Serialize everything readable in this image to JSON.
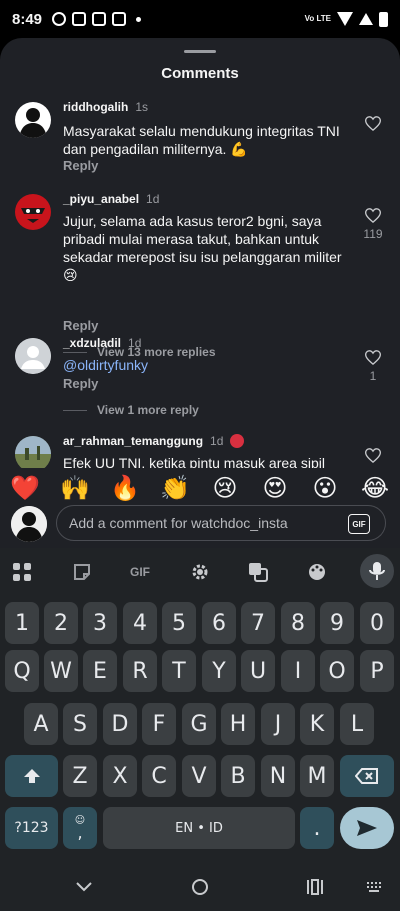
{
  "status_bar": {
    "time": "8:49",
    "network_label": "Vo LTE"
  },
  "sheet": {
    "title": "Comments"
  },
  "comments": [
    {
      "username": "riddhogalih",
      "time": "1s",
      "text": "Masyarakat selalu mendukung integritas TNI dan pengadilan militernya. 💪",
      "reply_label": "Reply",
      "like_count": ""
    },
    {
      "username": "_piyu_anabel",
      "time": "1d",
      "text": "Jujur, selama ada kasus teror2 bgni, saya pribadi mulai merasa takut, bahkan untuk sekadar merepost isu isu pelanggaran militer 😢",
      "reply_label": "Reply",
      "like_count": "119",
      "view_replies": "View 13 more replies"
    },
    {
      "username": "_xdzuladil",
      "time": "1d",
      "text": "@oldirtyfunky",
      "reply_label": "Reply",
      "like_count": "1",
      "view_replies": "View 1 more reply"
    },
    {
      "username": "ar_rahman_temanggung",
      "time": "1d",
      "text": "Efek UU TNI, ketika pintu masuk area sipil",
      "reply_label": "",
      "like_count": ""
    }
  ],
  "emoji_bar": [
    "❤️",
    "🙌",
    "🔥",
    "👏",
    "😢",
    "😍",
    "😮",
    "😂"
  ],
  "composer": {
    "placeholder": "Add a comment for watchdoc_insta",
    "gif_label": "GIF"
  },
  "keyboard": {
    "toolbar_gif_label": "GIF",
    "number_row": [
      "1",
      "2",
      "3",
      "4",
      "5",
      "6",
      "7",
      "8",
      "9",
      "0"
    ],
    "row1": [
      "Q",
      "W",
      "E",
      "R",
      "T",
      "Y",
      "U",
      "I",
      "O",
      "P"
    ],
    "row2": [
      "A",
      "S",
      "D",
      "F",
      "G",
      "H",
      "J",
      "K",
      "L"
    ],
    "row3": [
      "Z",
      "X",
      "C",
      "V",
      "B",
      "N",
      "M"
    ],
    "symbols_label": "?123",
    "comma_label": ",",
    "space_label": "EN • ID",
    "period_label": "."
  },
  "colors": {
    "sheet_background": "#1f2126",
    "keyboard_background": "#202326",
    "mention": "#8ab4f8",
    "function_key": "#2f4f5b",
    "enter_key": "#a7c7d4"
  }
}
